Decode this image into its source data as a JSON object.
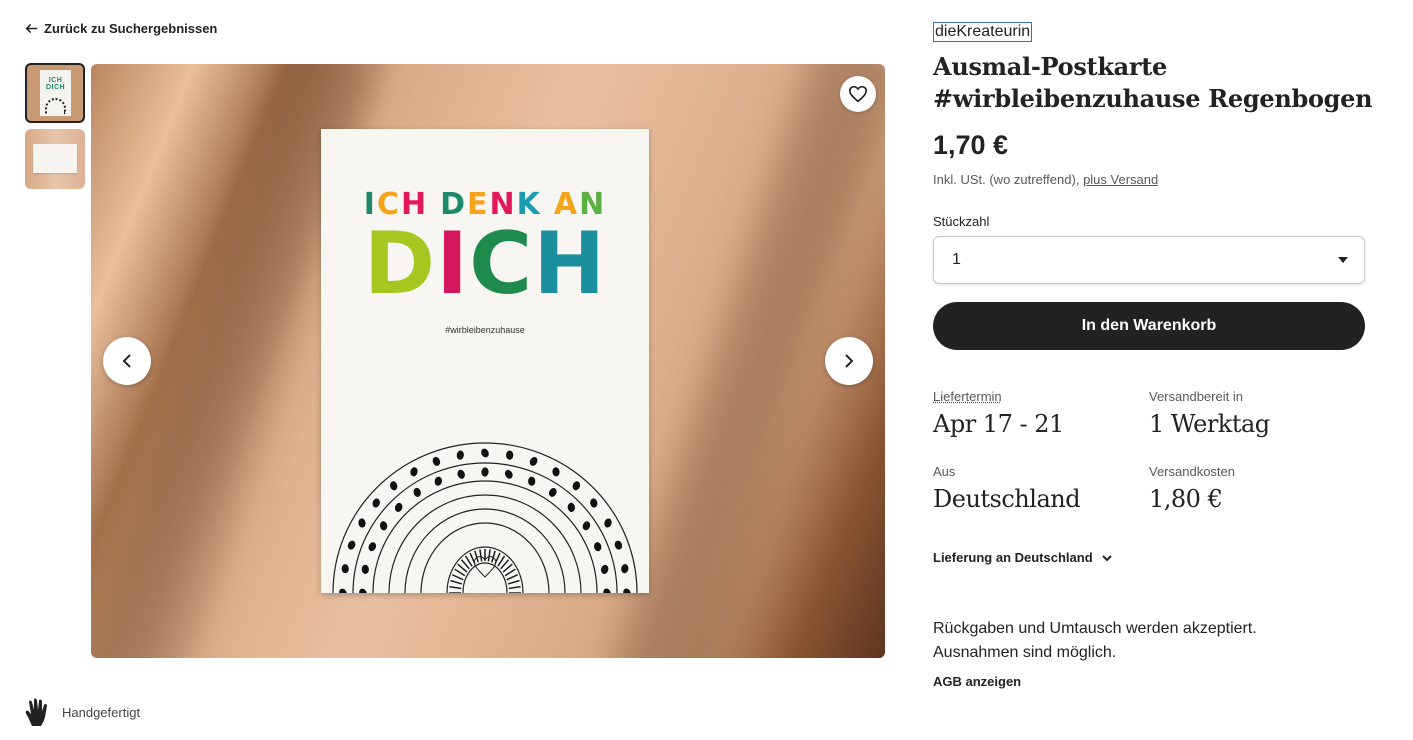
{
  "back_link": {
    "label": "Zurück zu Suchergebnissen",
    "icon": "arrow-left-icon"
  },
  "thumbnails": [
    {
      "name": "thumbnail-1",
      "selected": true,
      "mini_text": "ICH DICH"
    },
    {
      "name": "thumbnail-2",
      "selected": false
    }
  ],
  "gallery": {
    "favorite_icon": "heart-icon",
    "prev_icon": "chevron-left-icon",
    "next_icon": "chevron-right-icon",
    "postcard": {
      "line1": [
        "I",
        "C",
        "H",
        " ",
        "D",
        "E",
        "N",
        "K",
        " ",
        "A",
        "N"
      ],
      "line2": [
        "D",
        "I",
        "C",
        "H"
      ],
      "hashtag": "#wirbleibenzuhause"
    }
  },
  "product": {
    "shop_name": "dieKreateurin",
    "title": "Ausmal-Postkarte #wirbleibenzuhause Regenbogen",
    "price": "1,70 €",
    "tax_note": "Inkl. USt. (wo zutreffend),",
    "shipping_link": "plus Versand",
    "quantity_label": "Stückzahl",
    "quantity_value": "1",
    "cart_button": "In den Warenkorb"
  },
  "shipping": {
    "delivery_label": "Liefertermin",
    "delivery_value": "Apr 17 - 21",
    "ready_label": "Versandbereit in",
    "ready_value": "1 Werktag",
    "from_label": "Aus",
    "from_value": "Deutschland",
    "cost_label": "Versandkosten",
    "cost_value": "1,80 €",
    "delivery_toggle": "Lieferung an Deutschland"
  },
  "returns": {
    "line1": "Rückgaben und Umtausch werden akzeptiert.",
    "line2": "Ausnahmen sind möglich.",
    "agb_link": "AGB anzeigen"
  },
  "badge": {
    "label": "Handgefertigt",
    "icon": "hand-icon"
  },
  "colors": {
    "text": "#222222",
    "muted": "#595959",
    "button": "#222222",
    "letters": [
      "#1f8a6b",
      "#f4a51c",
      "#e2185b",
      "#1f8a6b",
      "#f4a51c",
      "#e2185b",
      "#1a9bb0",
      "#f4a51c",
      "#5ab043",
      "#e2185b"
    ],
    "letters2": [
      "#a6c720",
      "#d3175a",
      "#1e8a4c",
      "#1b8f9c"
    ]
  }
}
